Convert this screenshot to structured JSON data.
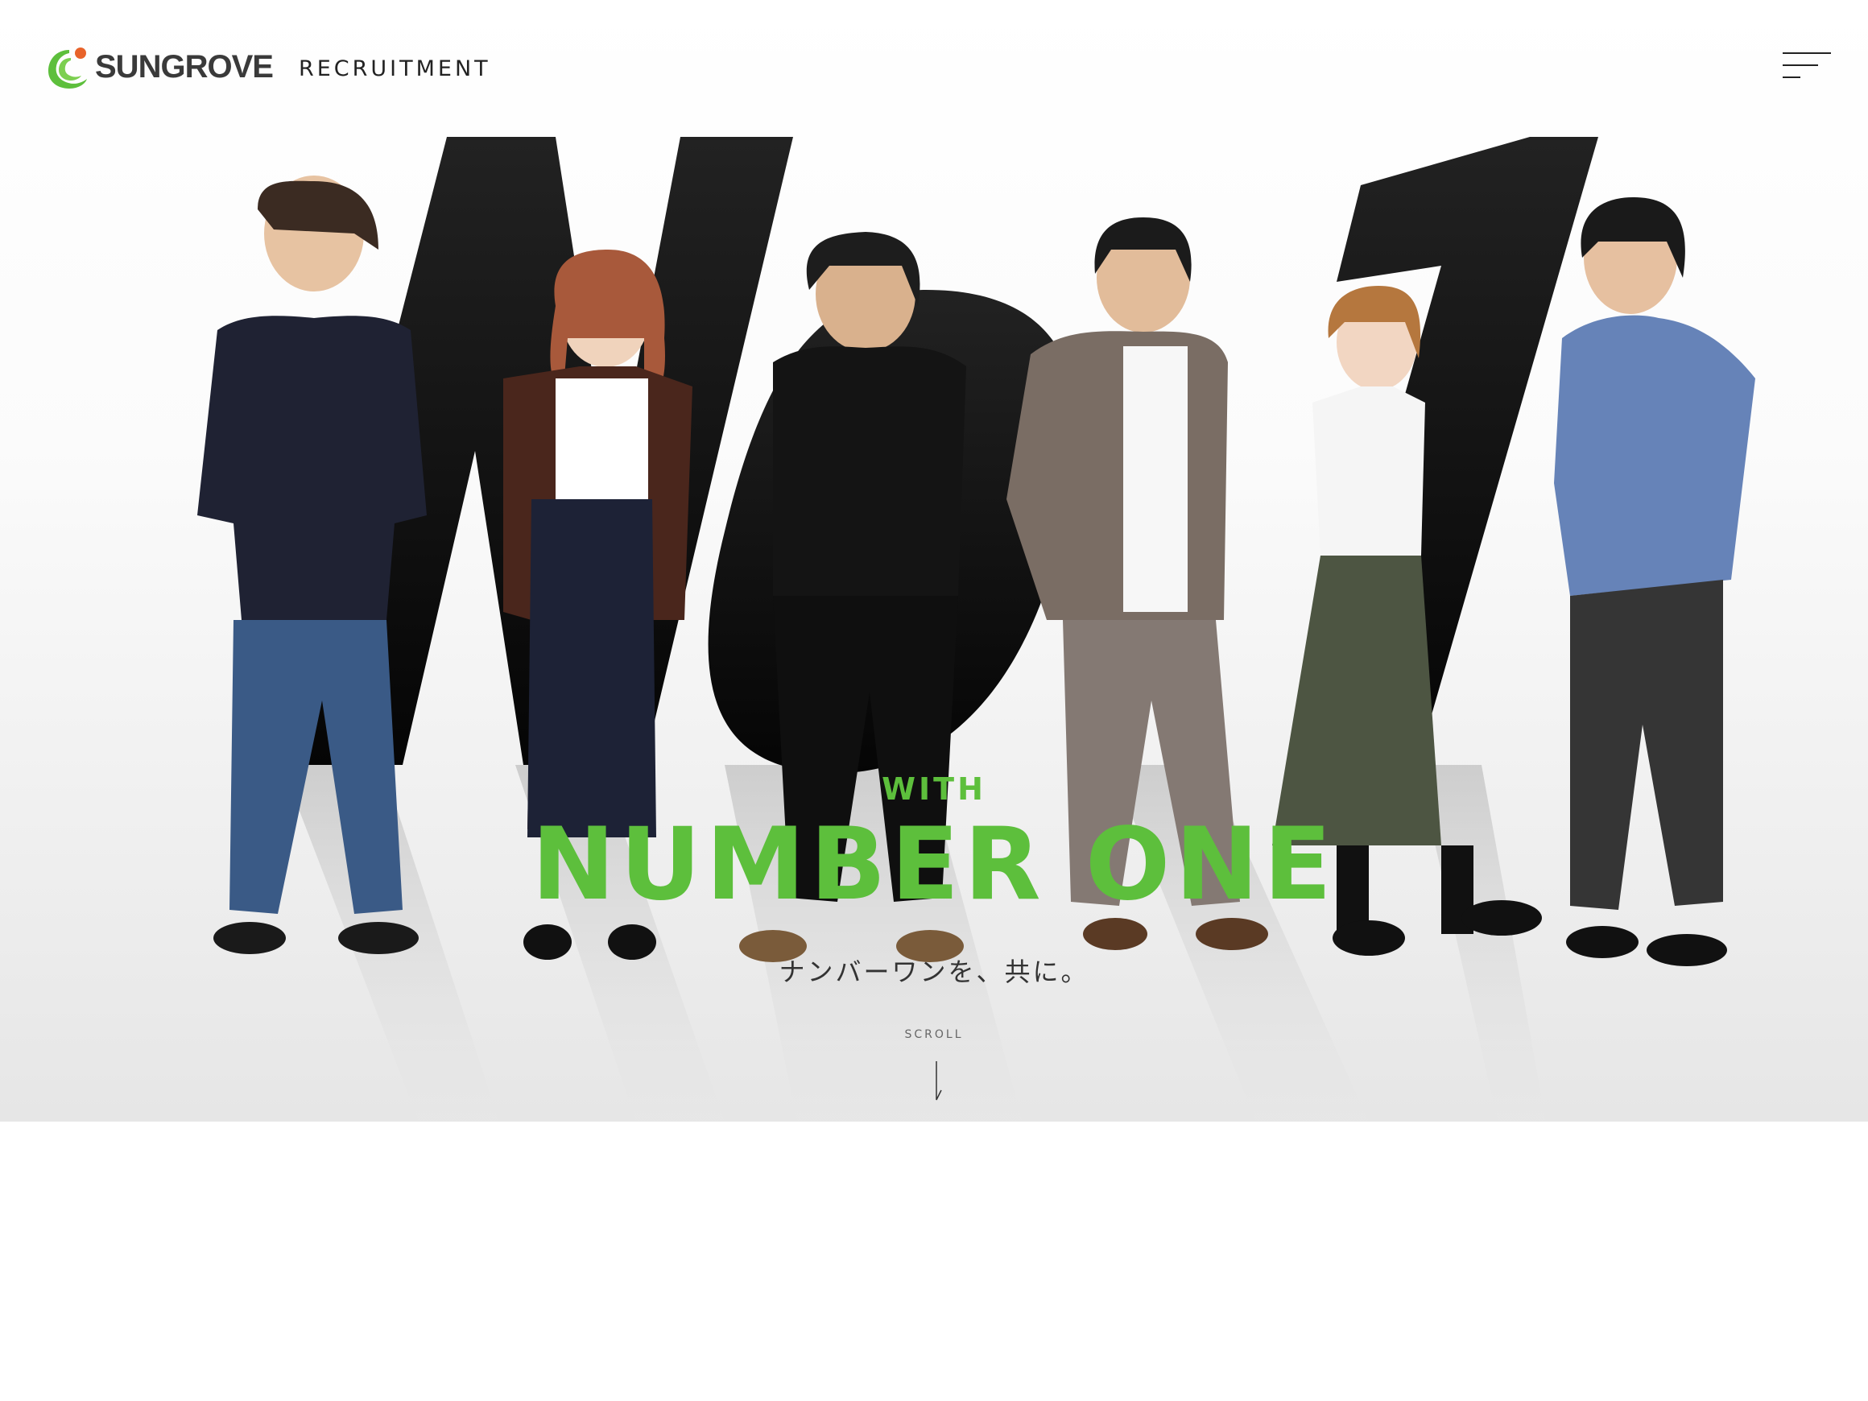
{
  "header": {
    "logo_text": "SUNGROVE",
    "logo_sub": "RECRUITMENT",
    "menu_icon": "hamburger-menu-icon"
  },
  "hero": {
    "background_text": "No1",
    "with_label": "WITH",
    "headline": "NUMBER ONE",
    "subtitle": "ナンバーワンを、共に。",
    "scroll_label": "SCROLL"
  },
  "colors": {
    "accent_green": "#5dbf3c",
    "logo_orange": "#e8632a",
    "text_dark": "#222222"
  }
}
